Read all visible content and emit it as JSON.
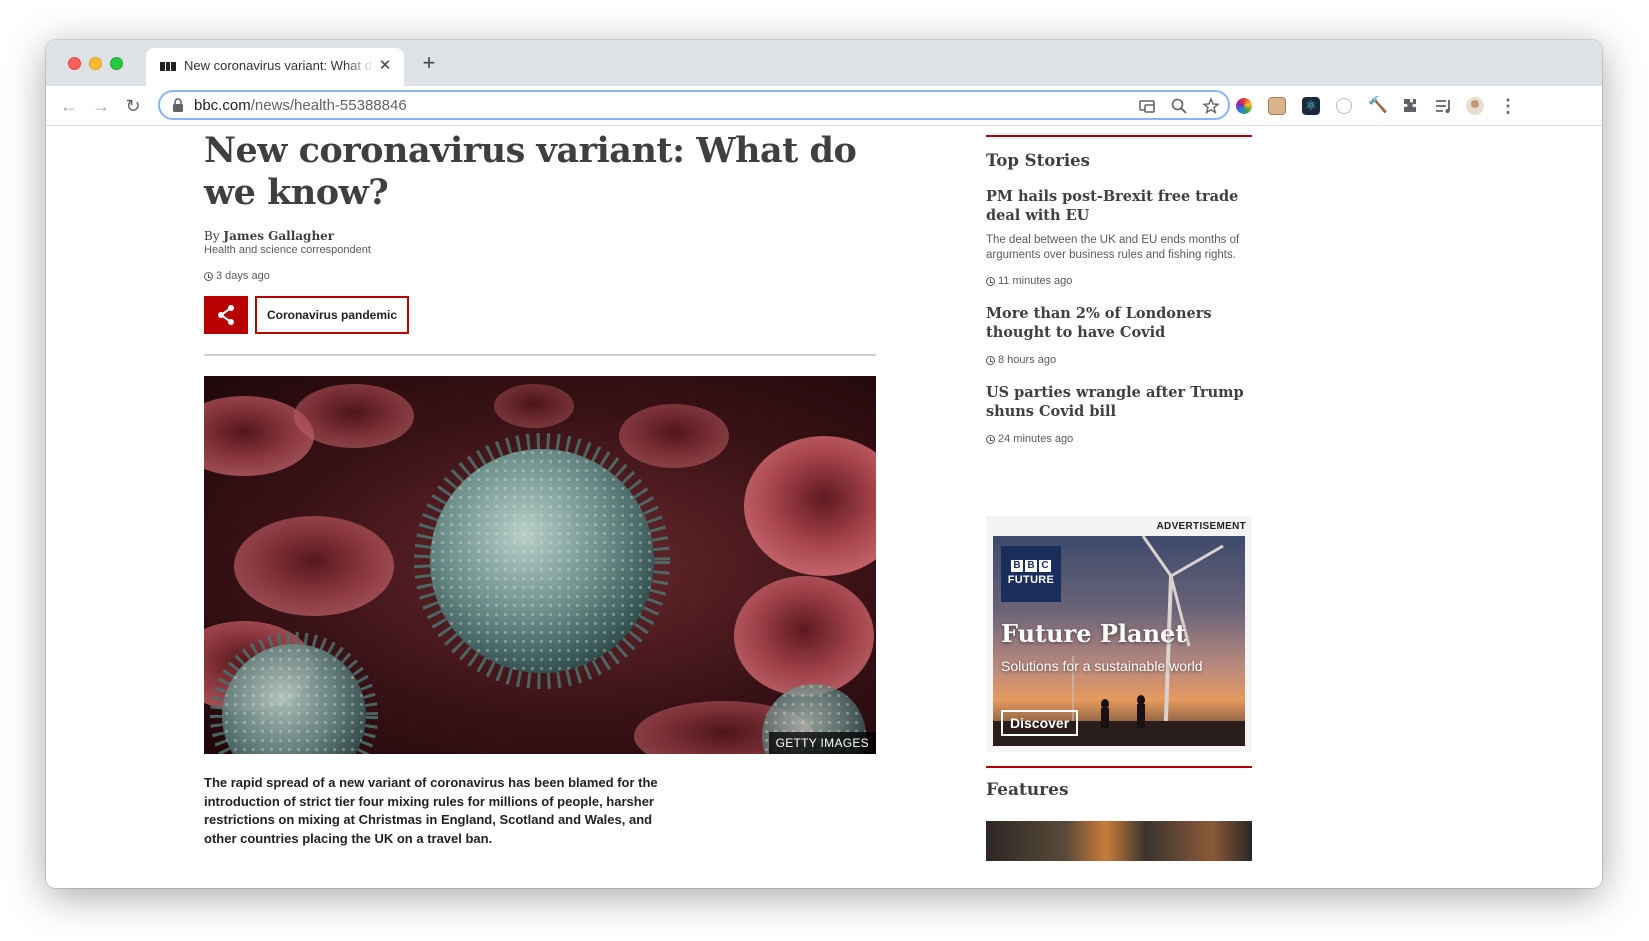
{
  "browser": {
    "tab_title": "New coronavirus variant: What do we know? - BBC News",
    "close_glyph": "✕",
    "new_tab_glyph": "+",
    "url_domain": "bbc.com",
    "url_path": "/news/health-55388846",
    "nav": {
      "back": "←",
      "forward": "→",
      "reload": "↻"
    },
    "omnibox_icons": [
      "cast-icon",
      "zoom-icon",
      "star-icon"
    ],
    "menu_glyph": "⋮"
  },
  "article": {
    "headline": "New coronavirus variant: What do we know?",
    "byline_prefix": "By ",
    "author": "James Gallagher",
    "role": "Health and science correspondent",
    "published": "3 days ago",
    "topic": "Coronavirus pandemic",
    "image_caption": "GETTY IMAGES",
    "intro": "The rapid spread of a new variant of coronavirus has been blamed for the introduction of strict tier four mixing rules for millions of people, harsher restrictions on mixing at Christmas in England, Scotland and Wales, and other countries placing the UK on a travel ban."
  },
  "sidebar": {
    "top_stories_heading": "Top Stories",
    "stories": [
      {
        "title": "PM hails post-Brexit free trade deal with EU",
        "summary": "The deal between the UK and EU ends months of arguments over business rules and fishing rights.",
        "time": "11 minutes ago"
      },
      {
        "title": "More than 2% of Londoners thought to have Covid",
        "summary": "",
        "time": "8 hours ago"
      },
      {
        "title": "US parties wrangle after Trump shuns Covid bill",
        "summary": "",
        "time": "24 minutes ago"
      }
    ],
    "ad": {
      "label": "ADVERTISEMENT",
      "logo_letters": [
        "B",
        "B",
        "C"
      ],
      "logo_word": "FUTURE",
      "title": "Future Planet",
      "subtitle": "Solutions for a sustainable world",
      "cta": "Discover"
    },
    "features_heading": "Features"
  },
  "colors": {
    "bbc_red": "#b80000",
    "text": "#3f3f42",
    "focus_ring": "#8ab4f8"
  }
}
